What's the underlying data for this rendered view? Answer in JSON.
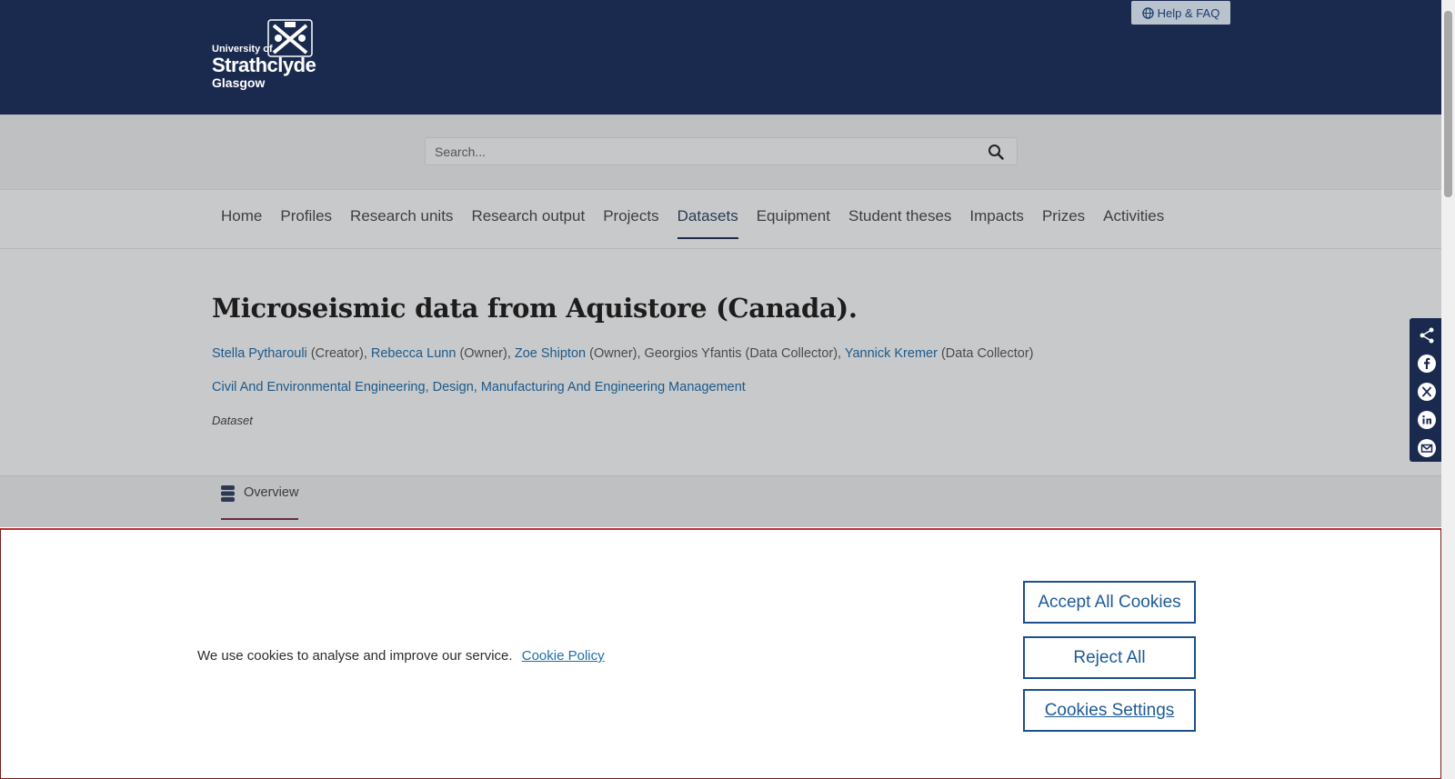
{
  "header": {
    "logo": {
      "line1": "University of",
      "line2": "Strathclyde",
      "line3": "Glasgow"
    },
    "help_label": "Help & FAQ"
  },
  "search": {
    "placeholder": "Search..."
  },
  "nav": {
    "items": [
      {
        "label": "Home"
      },
      {
        "label": "Profiles"
      },
      {
        "label": "Research units"
      },
      {
        "label": "Research output"
      },
      {
        "label": "Projects"
      },
      {
        "label": "Datasets"
      },
      {
        "label": "Equipment"
      },
      {
        "label": "Student theses"
      },
      {
        "label": "Impacts"
      },
      {
        "label": "Prizes"
      },
      {
        "label": "Activities"
      }
    ],
    "active": "Datasets"
  },
  "dataset": {
    "title": "Microseismic data from Aquistore (Canada).",
    "persons": [
      {
        "name": "Stella Pytharouli",
        "role": "(Creator)"
      },
      {
        "name": "Rebecca Lunn",
        "role": "(Owner)"
      },
      {
        "name": "Zoe Shipton",
        "role": "(Owner)"
      },
      {
        "name": "Georgios Yfantis",
        "role": "(Data Collector)"
      },
      {
        "name": "Yannick Kremer",
        "role": "(Data Collector)"
      }
    ],
    "units": [
      "Civil And Environmental Engineering",
      "Design, Manufacturing And Engineering Management"
    ],
    "type": "Dataset"
  },
  "tabs": {
    "overview": "Overview"
  },
  "share": [
    "share-icon",
    "facebook-icon",
    "x-icon",
    "linkedin-icon",
    "email-icon"
  ],
  "cookie": {
    "message": "We use cookies to analyse and improve our service.",
    "policy_link": "Cookie Policy",
    "accept": "Accept All Cookies",
    "reject": "Reject All",
    "settings": "Cookies Settings"
  }
}
